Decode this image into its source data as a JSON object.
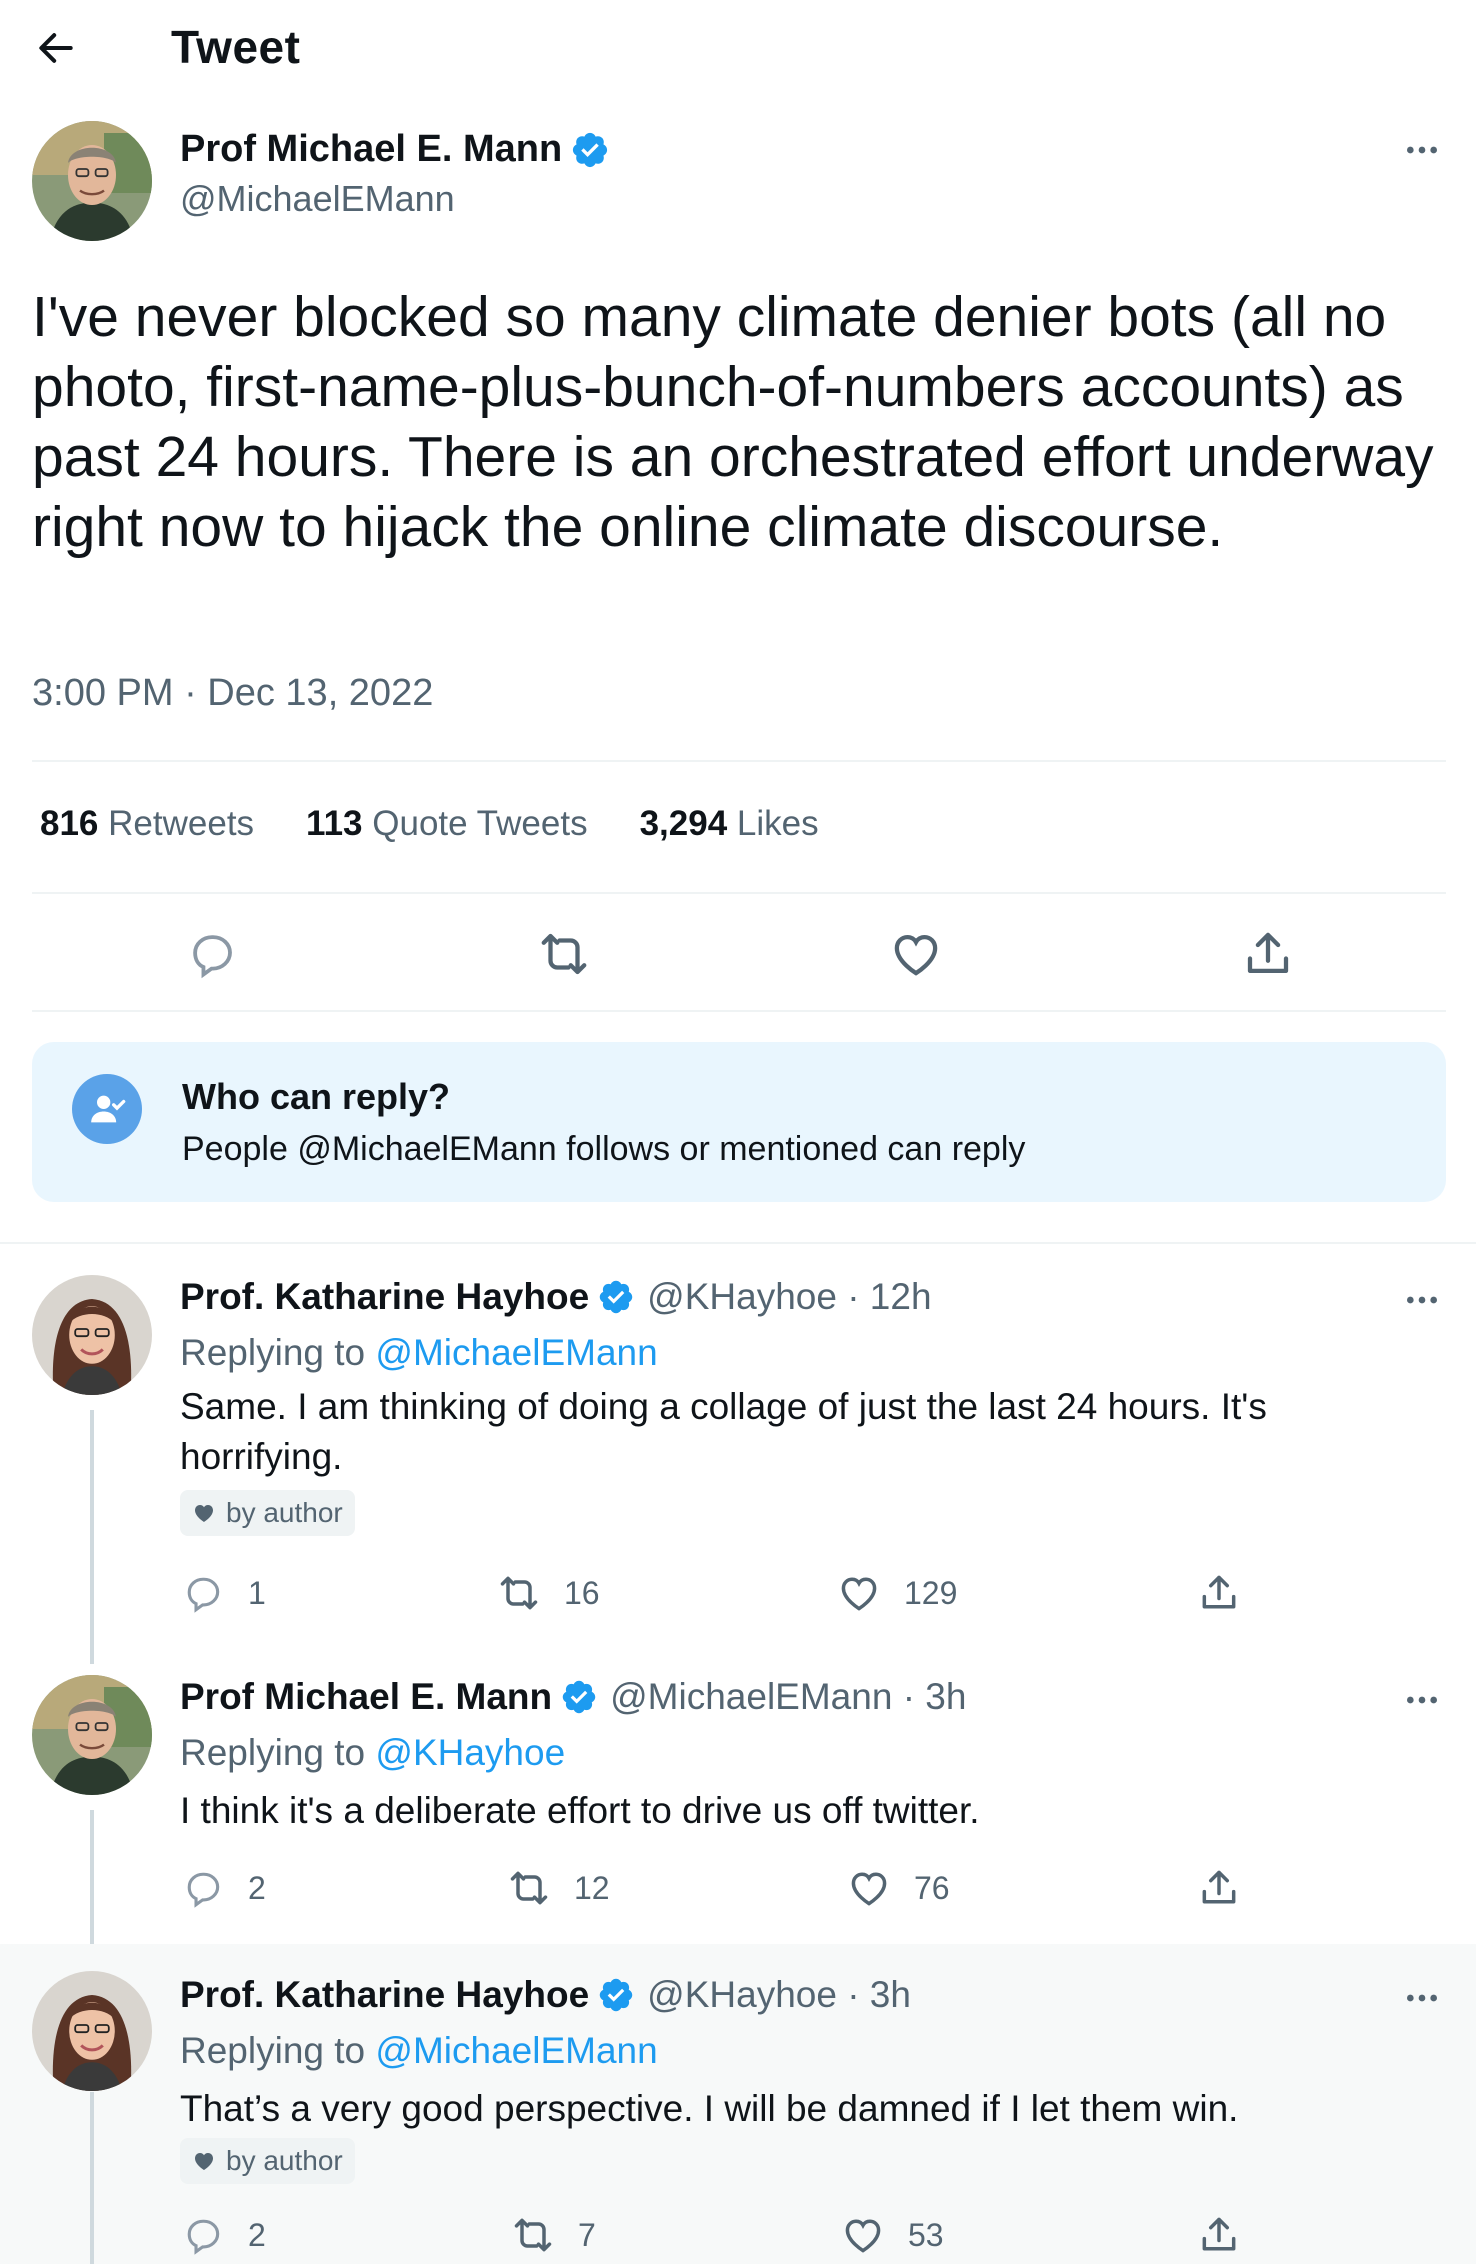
{
  "header": {
    "title": "Tweet"
  },
  "main_tweet": {
    "author_name": "Prof Michael E. Mann",
    "author_handle": "@MichaelEMann",
    "text": "I've never blocked so many climate denier bots (all no photo, first-name-plus-bunch-of-numbers accounts) as past 24 hours. There is an orchestrated effort underway right now to hijack the online climate discourse.",
    "timestamp": "3:00 PM · Dec 13, 2022",
    "stats": {
      "retweets_count": "816",
      "retweets_label": "Retweets",
      "quotes_count": "113",
      "quotes_label": "Quote Tweets",
      "likes_count": "3,294",
      "likes_label": "Likes"
    }
  },
  "who_can_reply": {
    "title": "Who can reply?",
    "description": "People @MichaelEMann follows or mentioned can reply"
  },
  "replies": [
    {
      "author_name": "Prof. Katharine Hayhoe",
      "meta": "@KHayhoe · 12h",
      "replying_label": "Replying to",
      "replying_to": "@MichaelEMann",
      "text": "Same. I am thinking of doing a collage of just the last 24 hours. It's horrifying.",
      "badge": "by author",
      "replies": "1",
      "retweets": "16",
      "likes": "129"
    },
    {
      "author_name": "Prof Michael E. Mann",
      "meta": "@MichaelEMann · 3h",
      "replying_label": "Replying to",
      "replying_to": "@KHayhoe",
      "text": "I think it's a deliberate effort to drive us off twitter.",
      "replies": "2",
      "retweets": "12",
      "likes": "76"
    },
    {
      "author_name": "Prof. Katharine Hayhoe",
      "meta": "@KHayhoe · 3h",
      "replying_label": "Replying to",
      "replying_to": "@MichaelEMann",
      "text": "That’s a very good perspective. I will be damned if I let them win.",
      "badge": "by author",
      "replies": "2",
      "retweets": "7",
      "likes": "53"
    }
  ],
  "colors": {
    "accent": "#1d9bf0",
    "secondary_text": "#536471",
    "who_box_bg": "#e9f6fe",
    "highlight_bg": "#f7f9f9"
  }
}
